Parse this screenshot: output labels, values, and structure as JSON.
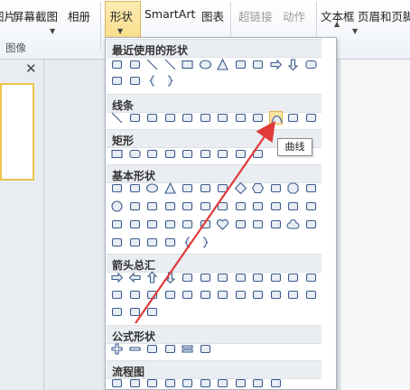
{
  "ribbon": {
    "tabs": [
      {
        "label": "图片"
      },
      {
        "label": "屏幕截图"
      },
      {
        "label": "相册"
      },
      {
        "label": "形状"
      },
      {
        "label": "SmartArt"
      },
      {
        "label": "图表"
      },
      {
        "label": "超链接",
        "disabled": true
      },
      {
        "label": "动作",
        "disabled": true
      },
      {
        "label": "文本框"
      },
      {
        "label": "页眉和页脚"
      }
    ],
    "group_label": "图像"
  },
  "pane": {
    "close_label": "✕"
  },
  "gallery": {
    "sections": [
      {
        "title": "最近使用的形状",
        "icons": [
          "picture-icon",
          "textbox-icon",
          "line-icon",
          "diagonal-line-icon",
          "rectangle-icon",
          "oval-icon",
          "triangle-icon",
          "elbow-connector-icon",
          "elbow-connector-icon",
          "right-arrow-icon",
          "down-arrow-icon",
          "rounded-rectangle-icon",
          "callout-icon",
          "curved-line-icon",
          "left-brace-icon",
          "right-brace-icon"
        ]
      },
      {
        "title": "线条",
        "icons": [
          "line-icon",
          "arrow-line-icon",
          "double-arrow-line-icon",
          "elbow-connector-icon",
          "elbow-arrow-connector-icon",
          "elbow-double-arrow-connector-icon",
          "curved-connector-icon",
          "curved-arrow-connector-icon",
          "curved-double-arrow-connector-icon",
          "curve-icon",
          "freeform-icon",
          "scribble-icon"
        ]
      },
      {
        "title": "矩形",
        "icons": [
          "rectangle-icon",
          "rounded-rectangle-icon",
          "snip-corner-rectangle-icon",
          "snip-corner-rectangle-icon",
          "snip-corner-rectangle-icon",
          "round-corner-rectangle-icon",
          "round-corner-rectangle-icon",
          "round-corner-rectangle-icon",
          "round-corner-rectangle-icon"
        ]
      },
      {
        "title": "基本形状",
        "icons": [
          "textbox-icon",
          "textbox-icon",
          "oval-icon",
          "triangle-icon",
          "right-triangle-icon",
          "parallelogram-icon",
          "trapezoid-icon",
          "diamond-icon",
          "hexagon-icon",
          "heptagon-icon",
          "octagon-icon",
          "decagon-icon",
          "circle-icon",
          "pie-icon",
          "chord-icon",
          "teardrop-icon",
          "frame-icon",
          "half-frame-icon",
          "l-shape-icon",
          "diagonal-stripe-icon",
          "cross-icon",
          "plaque-icon",
          "can-icon",
          "cube-icon",
          "bevel-icon",
          "donut-icon",
          "no-symbol-icon",
          "block-arc-icon",
          "folded-corner-icon",
          "smiley-icon",
          "heart-icon",
          "lightning-icon",
          "sun-icon",
          "moon-icon",
          "cloud-icon",
          "arc-icon",
          "bracket-pair-icon",
          "brace-pair-icon",
          "left-bracket-icon",
          "right-bracket-icon",
          "left-brace-icon",
          "right-brace-icon"
        ]
      },
      {
        "title": "箭头总汇",
        "icons": [
          "right-arrow-icon",
          "left-arrow-icon",
          "up-arrow-icon",
          "down-arrow-icon",
          "left-right-arrow-icon",
          "up-down-arrow-icon",
          "quad-arrow-icon",
          "left-right-up-arrow-icon",
          "bent-arrow-icon",
          "u-turn-arrow-icon",
          "left-up-arrow-icon",
          "bent-up-arrow-icon",
          "curved-right-arrow-icon",
          "curved-left-arrow-icon",
          "curved-up-arrow-icon",
          "curved-down-arrow-icon",
          "striped-right-arrow-icon",
          "notched-right-arrow-icon",
          "pentagon-arrow-icon",
          "chevron-icon",
          "right-arrow-callout-icon",
          "down-arrow-callout-icon",
          "left-arrow-callout-icon",
          "up-arrow-callout-icon",
          "left-right-arrow-callout-icon",
          "quad-arrow-callout-icon",
          "circular-arrow-icon"
        ]
      },
      {
        "title": "公式形状",
        "icons": [
          "plus-icon",
          "minus-icon",
          "multiply-icon",
          "divide-icon",
          "equal-icon",
          "not-equal-icon"
        ]
      },
      {
        "title": "流程图",
        "icons": [
          "process-icon",
          "alternate-process-icon",
          "decision-icon",
          "data-icon",
          "predefined-process-icon",
          "internal-storage-icon",
          "document-icon",
          "multidocument-icon",
          "terminator-icon",
          "preparation-icon"
        ]
      }
    ]
  },
  "tooltip": {
    "text": "曲线"
  },
  "annotation": {
    "color": "#e03a3a"
  }
}
